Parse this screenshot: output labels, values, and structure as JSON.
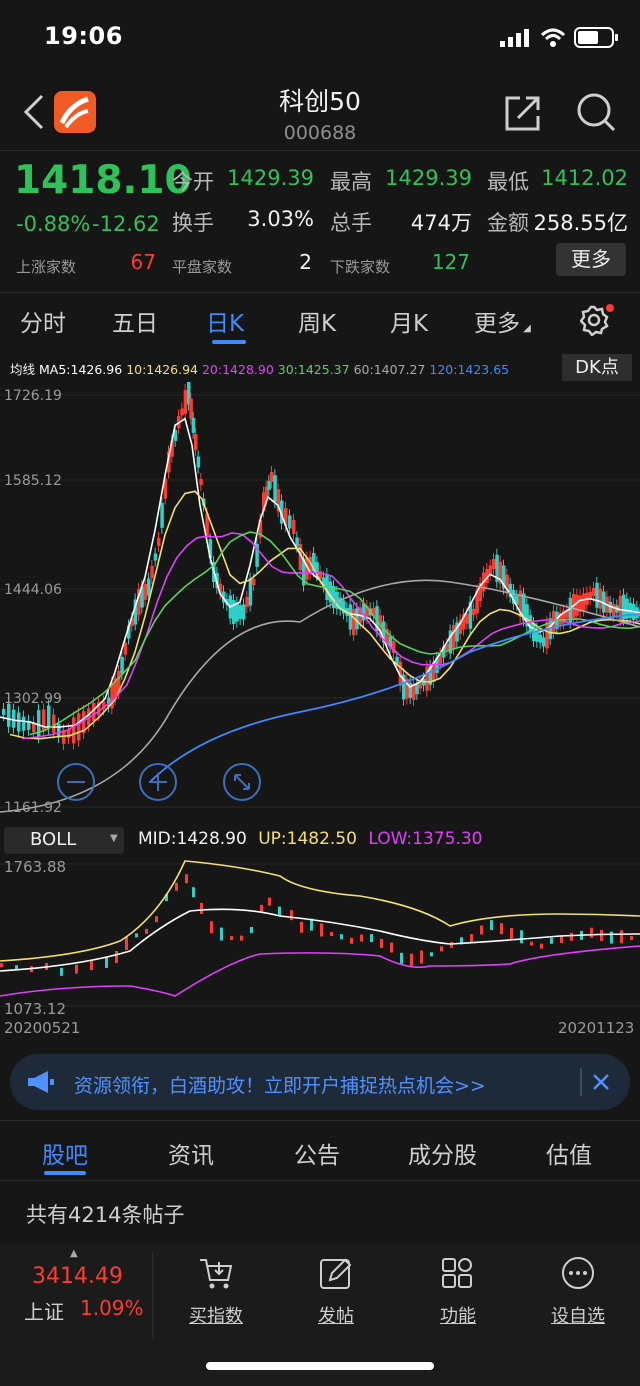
{
  "status_bar": {
    "time": "19:06"
  },
  "header": {
    "title": "科创50",
    "code": "000688"
  },
  "quote": {
    "price": "1418.10",
    "change_pct": "-0.88%",
    "change": "-12.62",
    "rows": [
      [
        {
          "label": "今开",
          "value": "1429.39",
          "color": "green"
        },
        {
          "label": "最高",
          "value": "1429.39",
          "color": "green"
        },
        {
          "label": "最低",
          "value": "1412.02",
          "color": "green"
        }
      ],
      [
        {
          "label": "换手",
          "value": "3.03%",
          "color": "white"
        },
        {
          "label": "总手",
          "value": "474万",
          "color": "white"
        },
        {
          "label": "金额",
          "value": "258.55亿",
          "color": "white"
        }
      ]
    ],
    "breadth": [
      {
        "label": "上涨家数",
        "value": "67",
        "color": "red"
      },
      {
        "label": "平盘家数",
        "value": "2",
        "color": "white"
      },
      {
        "label": "下跌家数",
        "value": "127",
        "color": "green"
      }
    ],
    "more_label": "更多"
  },
  "period_tabs": [
    "分时",
    "五日",
    "日K",
    "周K",
    "月K",
    "更多"
  ],
  "active_period": "日K",
  "ma_line": {
    "label": "均线",
    "items": [
      {
        "text": "MA5:1426.96",
        "color": "#ffffff"
      },
      {
        "text": "10:1426.94",
        "color": "#f4e06d"
      },
      {
        "text": "20:1428.90",
        "color": "#e040fb"
      },
      {
        "text": "30:1425.37",
        "color": "#56d45b"
      },
      {
        "text": "60:1407.27",
        "color": "#a9a9a9"
      },
      {
        "text": "120:1423.65",
        "color": "#3d8bff"
      }
    ],
    "dk_label": "DK点"
  },
  "main_axis": [
    "1726.19",
    "1585.12",
    "1444.06",
    "1302.99",
    "1161.92"
  ],
  "boll": {
    "selector": "BOLL",
    "mid": "MID:1428.90",
    "up": "UP:1482.50",
    "low": "LOW:1375.30",
    "axis_top": "1763.88",
    "axis_bottom": "1073.12",
    "date_start": "20200521",
    "date_end": "20201123"
  },
  "ad": {
    "text": "资源领衔，白酒助攻！立即开户捕捉热点机会>>"
  },
  "bottom_tabs": [
    "股吧",
    "资讯",
    "公告",
    "成分股",
    "估值"
  ],
  "posts_text": "共有4214条帖子",
  "toolbar": {
    "index_value": "3414.49",
    "index_name": "上证",
    "index_change": "1.09%",
    "buttons": [
      "买指数",
      "发帖",
      "功能",
      "设自选"
    ]
  },
  "colors": {
    "up": "#ff3b30",
    "down": "#2fc25b",
    "accent": "#3d8bff",
    "background": "#161616"
  }
}
